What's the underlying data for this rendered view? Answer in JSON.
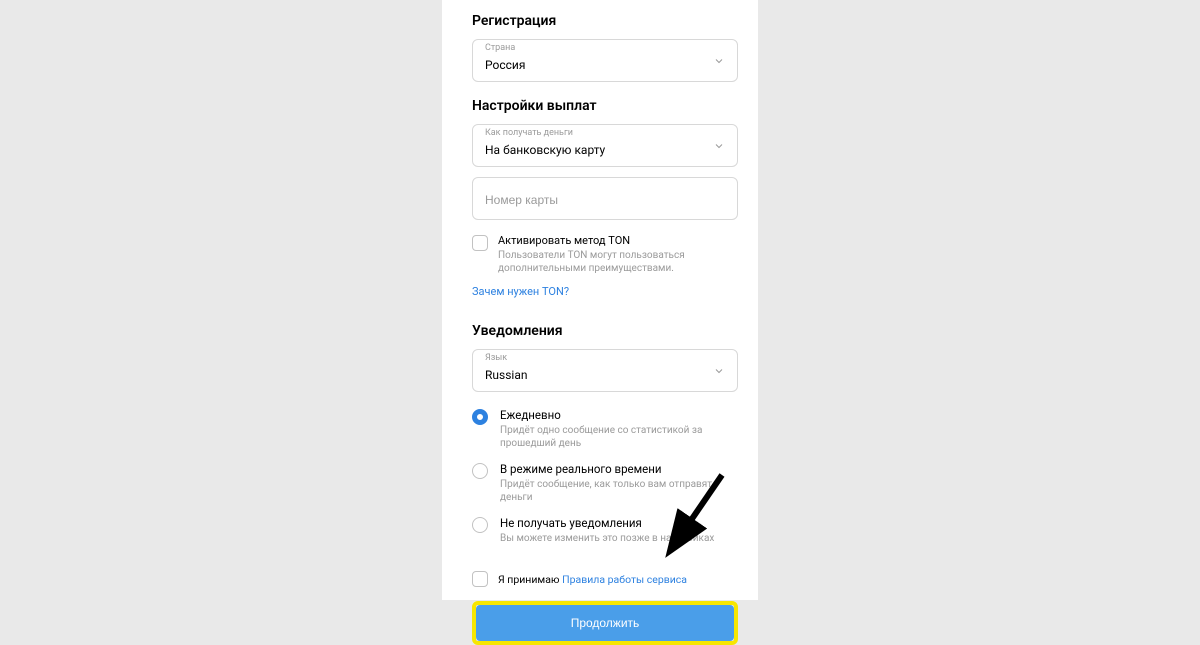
{
  "registration": {
    "title": "Регистрация",
    "country_label": "Страна",
    "country_value": "Россия"
  },
  "payout": {
    "title": "Настройки выплат",
    "method_label": "Как получать деньги",
    "method_value": "На банковскую карту",
    "card_placeholder": "Номер карты",
    "ton_title": "Активировать метод TON",
    "ton_desc": "Пользователи TON могут пользоваться дополнительными преимуществами.",
    "ton_link": "Зачем нужен TON?"
  },
  "notifications": {
    "title": "Уведомления",
    "lang_label": "Язык",
    "lang_value": "Russian",
    "options": [
      {
        "title": "Ежедневно",
        "desc": "Придёт одно сообщение со статистикой за прошедший день"
      },
      {
        "title": "В режиме реального времени",
        "desc": "Придёт сообщение, как только вам отправят деньги"
      },
      {
        "title": "Не получать уведомления",
        "desc": "Вы можете изменить это позже в настройках"
      }
    ]
  },
  "terms": {
    "prefix": "Я принимаю ",
    "link": "Правила работы сервиса"
  },
  "submit": {
    "label": "Продолжить"
  }
}
